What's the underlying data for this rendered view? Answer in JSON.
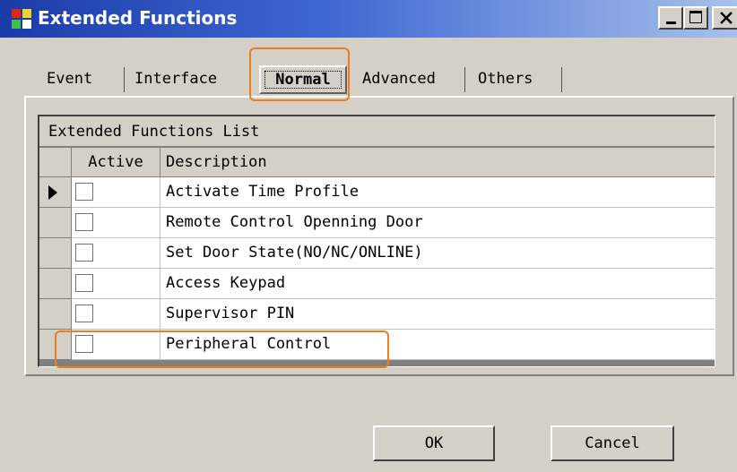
{
  "window": {
    "title": "Extended Functions",
    "controls": {
      "minimize_icon": "minimize-icon",
      "maximize_icon": "maximize-icon",
      "close_icon": "close-icon"
    }
  },
  "tabs": [
    {
      "label": "Event",
      "selected": false
    },
    {
      "label": "Interface",
      "selected": false
    },
    {
      "label": "Normal",
      "selected": true
    },
    {
      "label": "Advanced",
      "selected": false
    },
    {
      "label": "Others",
      "selected": false
    }
  ],
  "list": {
    "caption": "Extended Functions List",
    "columns": [
      "Active",
      "Description"
    ],
    "current_row": 0,
    "rows": [
      {
        "active": false,
        "description": "Activate Time Profile"
      },
      {
        "active": false,
        "description": "Remote Control Openning Door"
      },
      {
        "active": false,
        "description": "Set Door State(NO/NC/ONLINE)"
      },
      {
        "active": false,
        "description": "Access Keypad"
      },
      {
        "active": false,
        "description": "Supervisor PIN"
      },
      {
        "active": false,
        "description": "Peripheral Control"
      }
    ]
  },
  "buttons": {
    "ok": "OK",
    "cancel": "Cancel"
  },
  "colors": {
    "face": "#d4d0c8",
    "title_start": "#1b3ca8",
    "title_end": "#a8c0ec",
    "highlight": "#f07d19"
  }
}
